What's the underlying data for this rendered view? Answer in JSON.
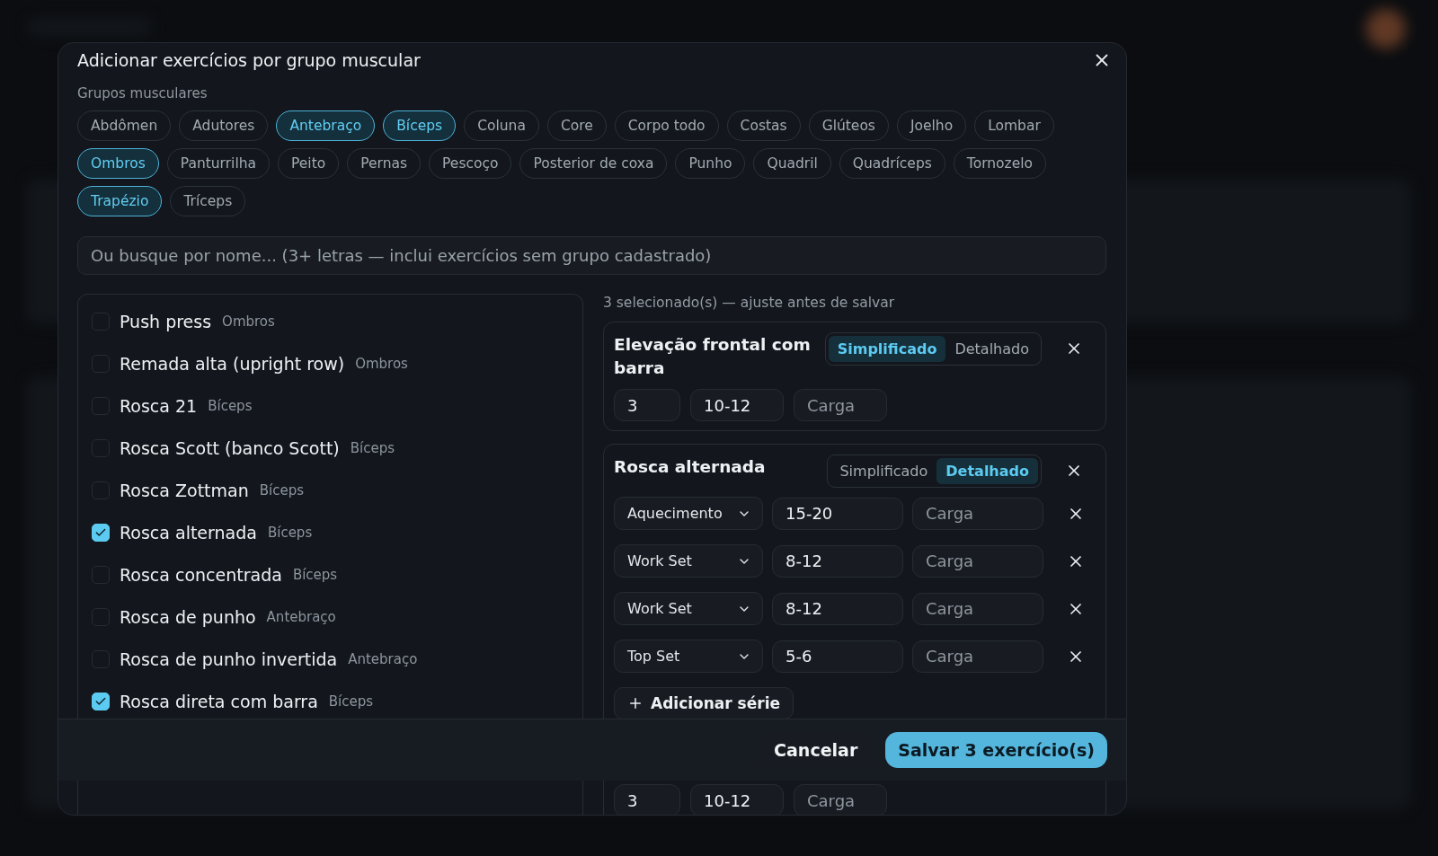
{
  "dialog": {
    "title": "Adicionar exercícios por grupo muscular",
    "groups_label": "Grupos musculares",
    "groups": [
      {
        "label": "Abdômen",
        "selected": false
      },
      {
        "label": "Adutores",
        "selected": false
      },
      {
        "label": "Antebraço",
        "selected": true
      },
      {
        "label": "Bíceps",
        "selected": true
      },
      {
        "label": "Coluna",
        "selected": false
      },
      {
        "label": "Core",
        "selected": false
      },
      {
        "label": "Corpo todo",
        "selected": false
      },
      {
        "label": "Costas",
        "selected": false
      },
      {
        "label": "Glúteos",
        "selected": false
      },
      {
        "label": "Joelho",
        "selected": false
      },
      {
        "label": "Lombar",
        "selected": false
      },
      {
        "label": "Ombros",
        "selected": true
      },
      {
        "label": "Panturrilha",
        "selected": false
      },
      {
        "label": "Peito",
        "selected": false
      },
      {
        "label": "Pernas",
        "selected": false
      },
      {
        "label": "Pescoço",
        "selected": false
      },
      {
        "label": "Posterior de coxa",
        "selected": false
      },
      {
        "label": "Punho",
        "selected": false
      },
      {
        "label": "Quadril",
        "selected": false
      },
      {
        "label": "Quadríceps",
        "selected": false
      },
      {
        "label": "Tornozelo",
        "selected": false
      },
      {
        "label": "Trapézio",
        "selected": true
      },
      {
        "label": "Tríceps",
        "selected": false
      }
    ],
    "search": {
      "placeholder": "Ou busque por nome... (3+ letras — inclui exercícios sem grupo cadastrado)"
    },
    "exercises": [
      {
        "name": "Push press",
        "group": "Ombros",
        "checked": false
      },
      {
        "name": "Remada alta (upright row)",
        "group": "Ombros",
        "checked": false
      },
      {
        "name": "Rosca 21",
        "group": "Bíceps",
        "checked": false
      },
      {
        "name": "Rosca Scott (banco Scott)",
        "group": "Bíceps",
        "checked": false
      },
      {
        "name": "Rosca Zottman",
        "group": "Bíceps",
        "checked": false
      },
      {
        "name": "Rosca alternada",
        "group": "Bíceps",
        "checked": true
      },
      {
        "name": "Rosca concentrada",
        "group": "Bíceps",
        "checked": false
      },
      {
        "name": "Rosca de punho",
        "group": "Antebraço",
        "checked": false
      },
      {
        "name": "Rosca de punho invertida",
        "group": "Antebraço",
        "checked": false
      },
      {
        "name": "Rosca direta com barra",
        "group": "Bíceps",
        "checked": true
      }
    ],
    "selected_summary": "3 selecionado(s) — ajuste antes de salvar",
    "selected": [
      {
        "title": "Elevação frontal com barra",
        "modes": [
          {
            "label": "Simplificado",
            "selected": true
          },
          {
            "label": "Detalhado",
            "selected": false
          }
        ],
        "sets": "3",
        "reps": "10-12",
        "load_placeholder": "Carga"
      },
      {
        "title": "Rosca alternada",
        "modes": [
          {
            "label": "Simplificado",
            "selected": false
          },
          {
            "label": "Detalhado",
            "selected": true
          }
        ],
        "series": [
          {
            "type": "Aquecimento",
            "reps": "15-20",
            "load_placeholder": "Carga"
          },
          {
            "type": "Work Set",
            "reps": "8-12",
            "load_placeholder": "Carga"
          },
          {
            "type": "Work Set",
            "reps": "8-12",
            "load_placeholder": "Carga"
          },
          {
            "type": "Top Set",
            "reps": "5-6",
            "load_placeholder": "Carga"
          }
        ],
        "add_series": "Adicionar série"
      },
      {
        "sets": "3",
        "reps": "10-12",
        "load_placeholder": "Carga"
      }
    ],
    "cancel": "Cancelar",
    "save": "Salvar 3 exercício(s)"
  }
}
